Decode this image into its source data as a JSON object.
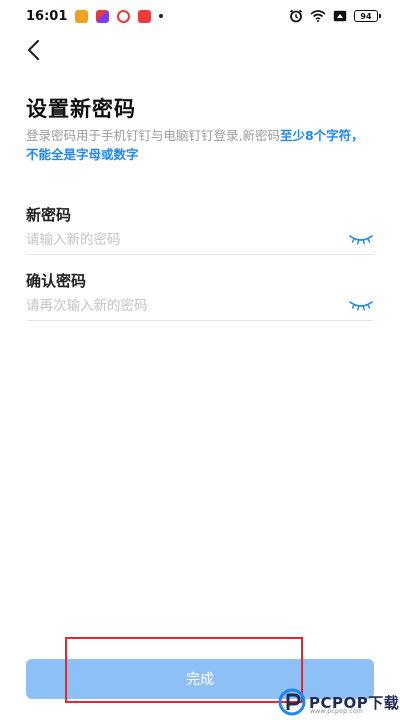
{
  "status_bar": {
    "time": "16:01",
    "battery": "94",
    "icons": [
      "app-icon-orange",
      "app-icon-purple",
      "app-icon-red-ring",
      "app-icon-red",
      "alarm-icon",
      "wifi-icon",
      "sim-icon",
      "battery-icon"
    ],
    "colors": {
      "app1": "#f0a21c",
      "app2": "#7a3df0",
      "app3": "#e33b3b",
      "app4": "#ee3a3a"
    }
  },
  "header": {
    "back_icon": "chevron-left-icon"
  },
  "page": {
    "title": "设置新密码",
    "subtitle_plain": "登录密码用于手机钉钉与电脑钉钉登录,新密码",
    "subtitle_highlight": "至少8个字符，不能全是字母或数字"
  },
  "form": {
    "new_password": {
      "label": "新密码",
      "value": "",
      "placeholder": "请输入新的密码",
      "icon": "eye-closed-icon"
    },
    "confirm_password": {
      "label": "确认密码",
      "value": "",
      "placeholder": "请再次输入新的密码",
      "icon": "eye-closed-icon"
    }
  },
  "actions": {
    "done_label": "完成"
  },
  "watermark": {
    "text": "PCPOP下载",
    "sub": "www.pcpop.com"
  },
  "colors": {
    "accent": "#1f86f5",
    "button_disabled": "#8ec0f8",
    "highlight_box": "#e8262c"
  }
}
